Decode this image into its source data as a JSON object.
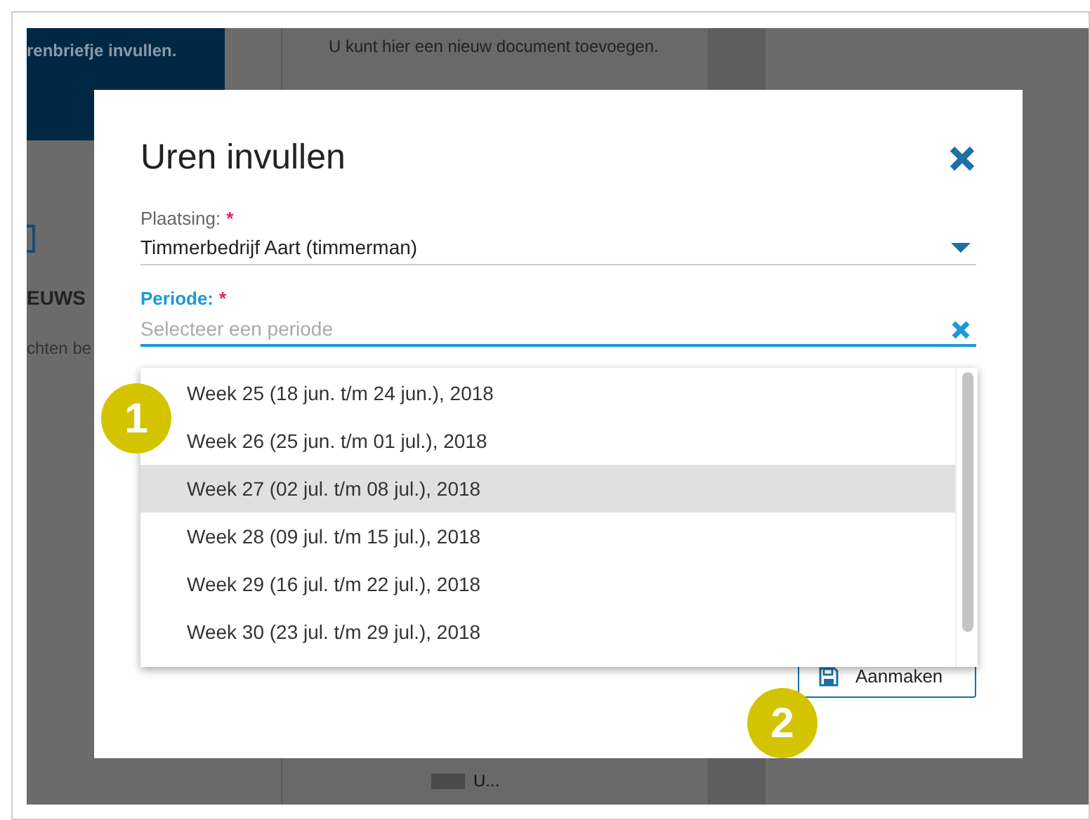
{
  "background": {
    "banner_text": "renbriefje invullen.",
    "card_text": "U kunt hier een nieuw document toevoegen.",
    "heading": "EUWS",
    "body_text": "chten be",
    "footer_item": "U..."
  },
  "dialog": {
    "title": "Uren invullen",
    "fields": [
      {
        "kind": "select",
        "label": "Plaatsing:",
        "required_mark": "*",
        "value": "Timmerbedrijf Aart (timmerman)",
        "focused": false
      },
      {
        "kind": "combobox",
        "label": "Periode:",
        "required_mark": "*",
        "placeholder": "Selecteer een periode",
        "focused": true
      }
    ],
    "options": [
      {
        "label": "Week 25 (18 jun. t/m 24 jun.), 2018",
        "selected": false
      },
      {
        "label": "Week 26 (25 jun. t/m 01 jul.), 2018",
        "selected": false
      },
      {
        "label": "Week 27 (02 jul. t/m 08 jul.), 2018",
        "selected": true
      },
      {
        "label": "Week 28 (09 jul. t/m 15 jul.), 2018",
        "selected": false
      },
      {
        "label": "Week 29 (16 jul. t/m 22 jul.), 2018",
        "selected": false
      },
      {
        "label": "Week 30 (23 jul. t/m 29 jul.), 2018",
        "selected": false
      }
    ],
    "button": "Aanmaken"
  },
  "callouts": [
    "1",
    "2"
  ]
}
